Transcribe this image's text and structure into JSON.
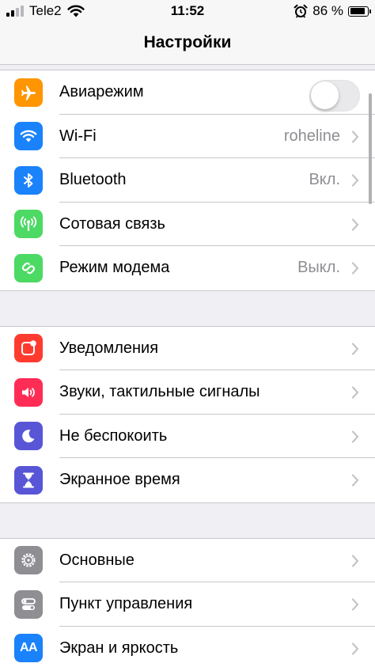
{
  "status_bar": {
    "carrier": "Tele2",
    "time": "11:52",
    "battery_percent": "86 %",
    "battery_level": 0.86,
    "signal_bars": 4,
    "signal_bars_filled": 2
  },
  "nav": {
    "title": "Настройки"
  },
  "colors": {
    "orange": "#ff9500",
    "blue": "#1a82fb",
    "green": "#4cd964",
    "red": "#ff3b30",
    "pink": "#ff2d55",
    "purple": "#5856d6",
    "gray": "#8e8e93"
  },
  "groups": [
    {
      "rows": [
        {
          "label": "Авиарежим",
          "icon": "airplane-icon",
          "toggle": false
        },
        {
          "label": "Wi-Fi",
          "icon": "wifi-icon",
          "value": "roheline"
        },
        {
          "label": "Bluetooth",
          "icon": "bluetooth-icon",
          "value": "Вкл."
        },
        {
          "label": "Сотовая связь",
          "icon": "cellular-antenna-icon"
        },
        {
          "label": "Режим модема",
          "icon": "personal-hotspot-icon",
          "value": "Выкл."
        }
      ]
    },
    {
      "rows": [
        {
          "label": "Уведомления",
          "icon": "notifications-icon"
        },
        {
          "label": "Звуки, тактильные сигналы",
          "icon": "speaker-icon"
        },
        {
          "label": "Не беспокоить",
          "icon": "moon-icon"
        },
        {
          "label": "Экранное время",
          "icon": "hourglass-icon"
        }
      ]
    },
    {
      "rows": [
        {
          "label": "Основные",
          "icon": "gear-icon"
        },
        {
          "label": "Пункт управления",
          "icon": "control-center-icon"
        },
        {
          "label": "Экран и яркость",
          "icon": "display-brightness-icon",
          "icon_text": "AA"
        }
      ]
    }
  ]
}
